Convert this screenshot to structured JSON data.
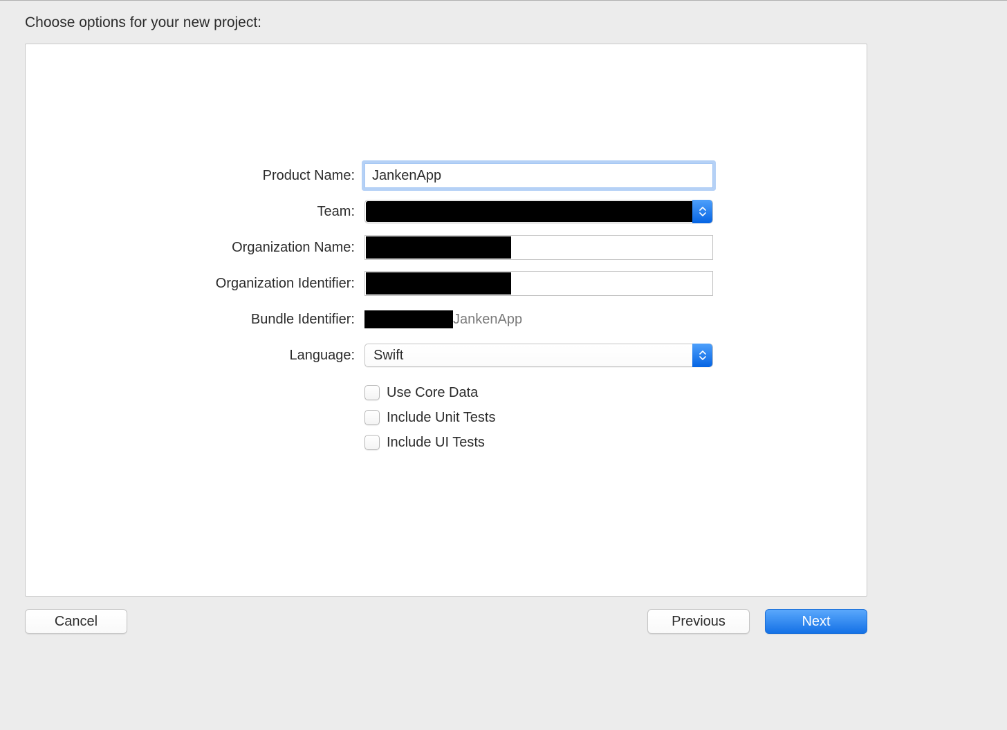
{
  "title": "Choose options for your new project:",
  "fields": {
    "product_name": {
      "label": "Product Name:",
      "value": "JankenApp"
    },
    "team": {
      "label": "Team:"
    },
    "org_name": {
      "label": "Organization Name:"
    },
    "org_identifier": {
      "label": "Organization Identifier:"
    },
    "bundle_identifier": {
      "label": "Bundle Identifier:",
      "suffix": "JankenApp"
    },
    "language": {
      "label": "Language:",
      "value": "Swift"
    }
  },
  "options": {
    "core_data": "Use Core Data",
    "unit_tests": "Include Unit Tests",
    "ui_tests": "Include UI Tests"
  },
  "buttons": {
    "cancel": "Cancel",
    "previous": "Previous",
    "next": "Next"
  }
}
